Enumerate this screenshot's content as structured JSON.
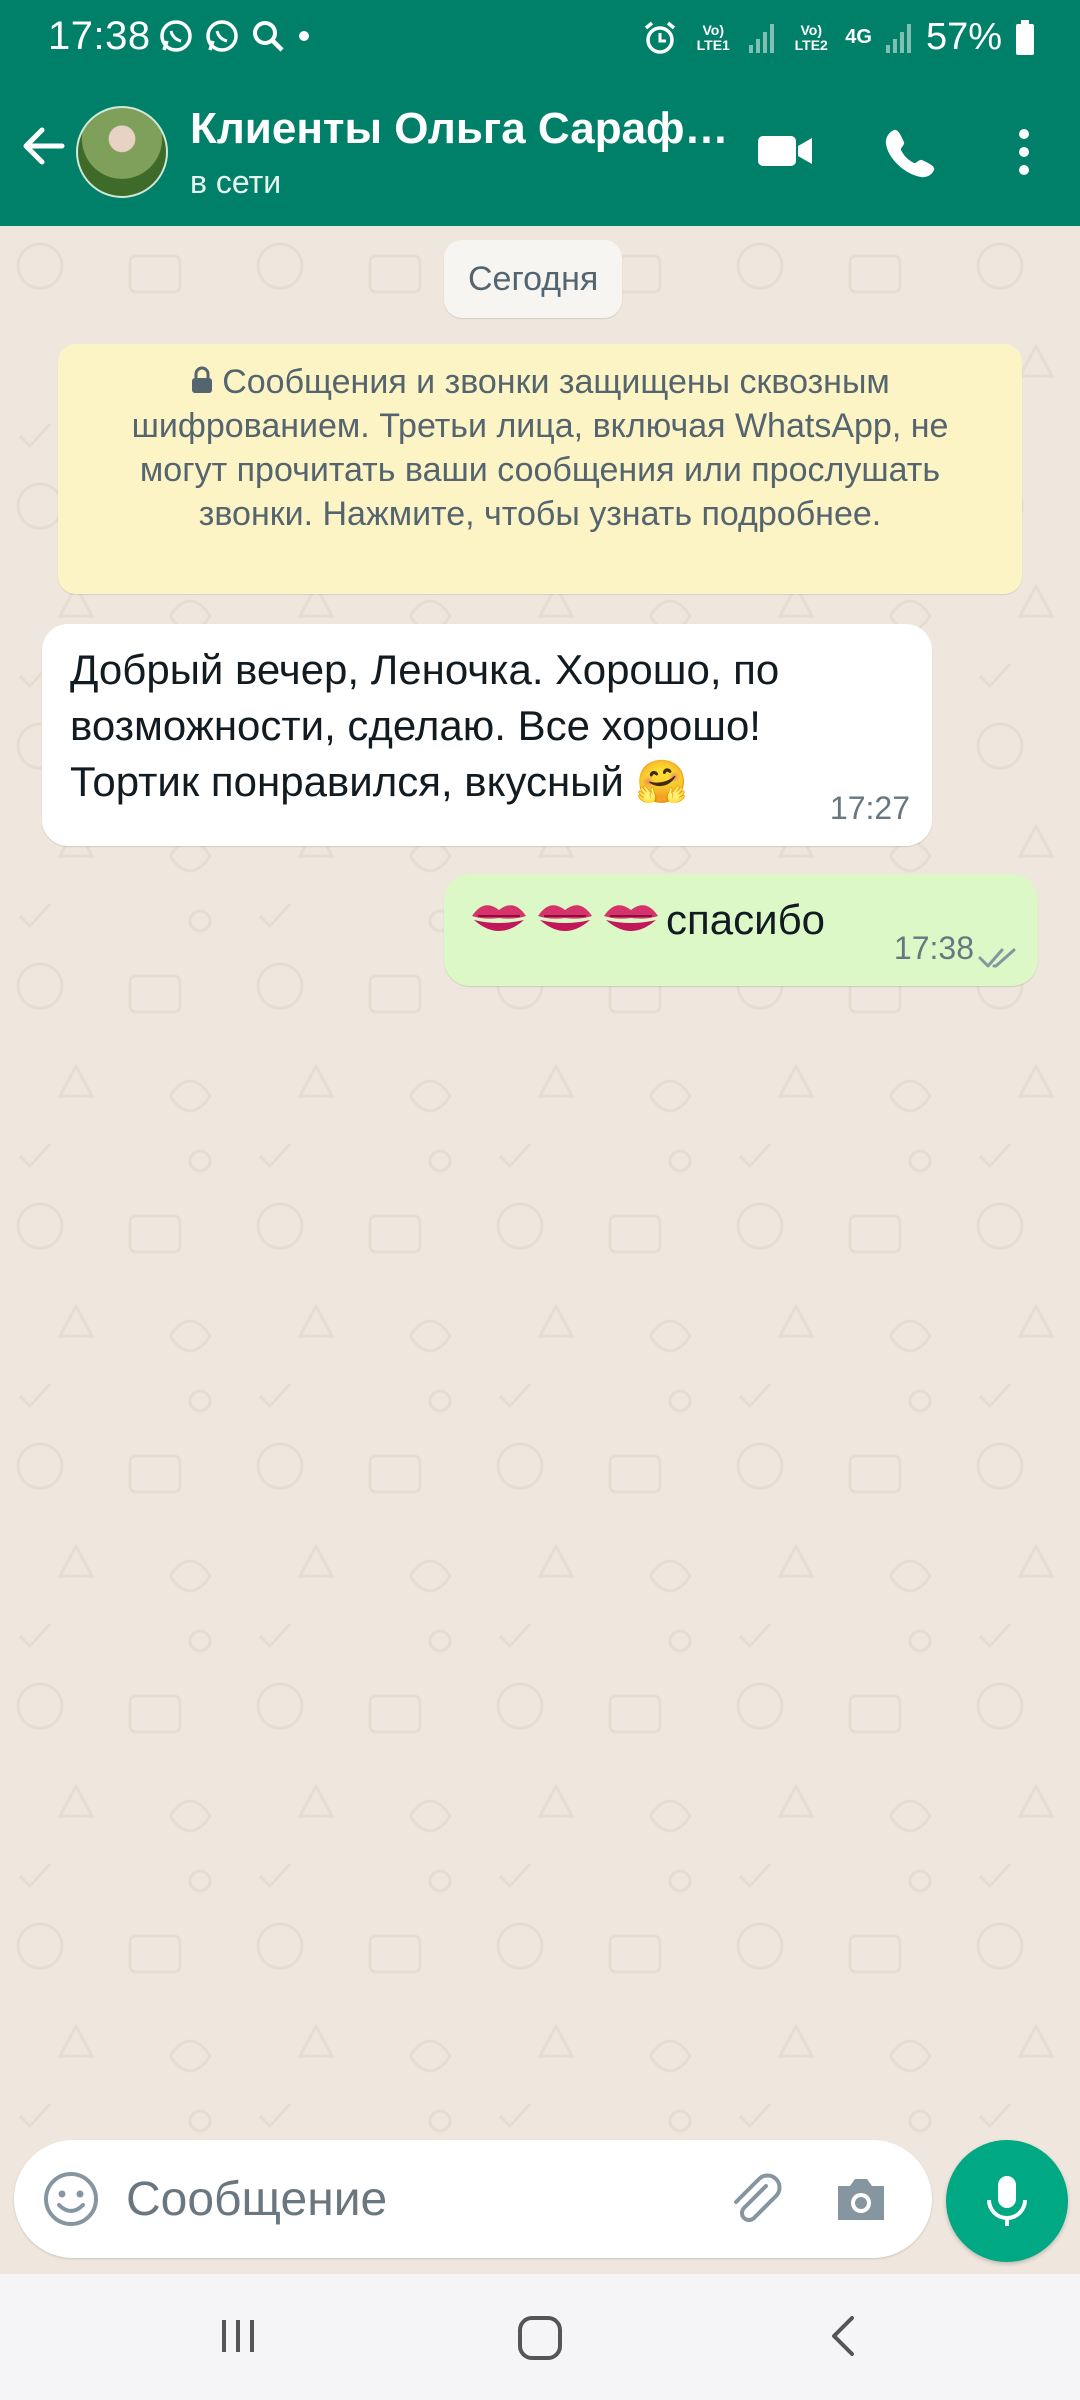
{
  "status_bar": {
    "time": "17:38",
    "network_sim1": "Vo) LTE1",
    "network_sim2": "Vo) LTE2",
    "network_type": "4G",
    "battery": "57%"
  },
  "header": {
    "title": "Клиенты Ольга Сараф…",
    "subtitle": "в сети"
  },
  "chat": {
    "date_chip": "Сегодня",
    "encryption_notice": "Сообщения и звонки защищены сквозным шифрованием. Третьи лица, включая WhatsApp, не могут прочитать ваши сообщения или прослушать звонки. Нажмите, чтобы узнать подробнее.",
    "messages": [
      {
        "direction": "incoming",
        "text_line1": "Добрый вечер, Леночка. Хорошо, по",
        "text_line2": "возможности, сделаю. Все хорошо!",
        "text_line3": "Тортик понравился, вкусный 🤗",
        "time": "17:27"
      },
      {
        "direction": "outgoing",
        "text": "спасибо",
        "emoji_count": 3,
        "emoji": "kiss-mark",
        "time": "17:38",
        "status": "delivered"
      }
    ]
  },
  "composer": {
    "placeholder": "Сообщение"
  },
  "colors": {
    "header": "#008069",
    "outgoing_bubble": "#dcf8c6",
    "incoming_bubble": "#ffffff",
    "notice_bg": "#fdf4c5",
    "mic_button": "#00a884",
    "chat_bg": "#efe7dd"
  }
}
